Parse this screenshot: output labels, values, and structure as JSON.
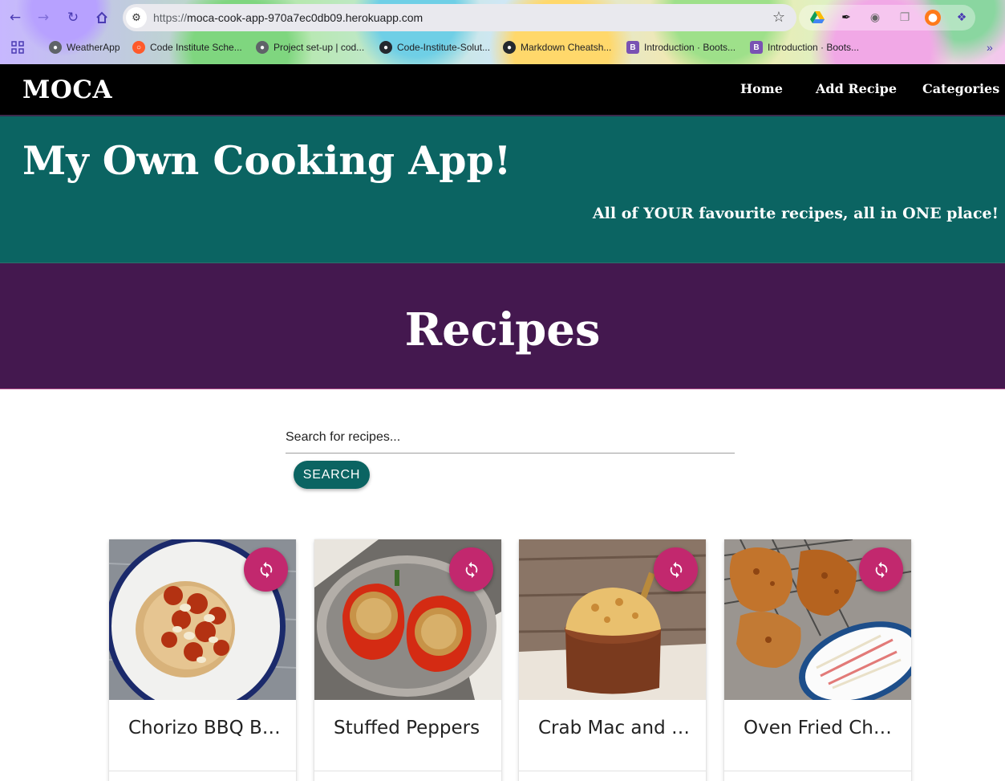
{
  "browser": {
    "url_scheme": "https://",
    "url_host": "moca-cook-app-970a7ec0db09.herokuapp.com",
    "bookmarks": [
      {
        "label": "WeatherApp",
        "icon": "globe-icon"
      },
      {
        "label": "Code Institute Sche...",
        "icon": "code-institute-icon"
      },
      {
        "label": "Project set-up | cod...",
        "icon": "globe-icon"
      },
      {
        "label": "Code-Institute-Solut...",
        "icon": "github-icon"
      },
      {
        "label": "Markdown Cheatsh...",
        "icon": "github-icon"
      },
      {
        "label": "Introduction · Boots...",
        "icon": "bootstrap-icon"
      },
      {
        "label": "Introduction · Boots...",
        "icon": "bootstrap-icon"
      }
    ]
  },
  "nav": {
    "brand": "MOCA",
    "links": [
      "Home",
      "Add Recipe",
      "Categories"
    ]
  },
  "hero": {
    "title": "My Own Cooking App!",
    "subtitle": "All of YOUR favourite recipes, all in ONE place!"
  },
  "recipes": {
    "heading": "Recipes",
    "search_placeholder": "Search for recipes...",
    "search_button": "SEARCH",
    "cards": [
      {
        "title": "Chorizo BBQ Beans"
      },
      {
        "title": "Stuffed Peppers"
      },
      {
        "title": "Crab Mac and Cheese"
      },
      {
        "title": "Oven Fried Chicken"
      }
    ]
  },
  "colors": {
    "nav_bg": "#000000",
    "hero_bg": "#0b6462",
    "banner_bg": "#44184f",
    "accent_button": "#0b6462",
    "flip_button": "#c2286e"
  }
}
